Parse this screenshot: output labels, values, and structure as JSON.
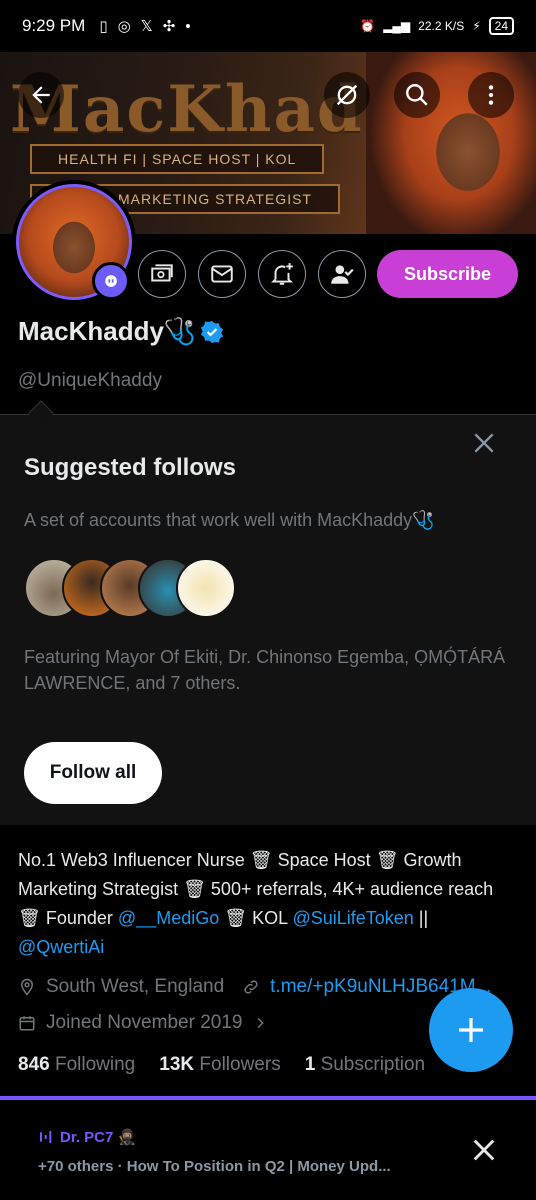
{
  "status": {
    "time": "9:29 PM",
    "left_icons": [
      "sim-icon",
      "whatsapp-icon",
      "x-icon",
      "app-icon",
      "dot-icon"
    ],
    "right_text": "22.2 K/S",
    "battery": "24"
  },
  "banner": {
    "title": "MacKhaddy",
    "tag1": "HEALTH FI | SPACE HOST | KOL",
    "tag2": "MARKETING STRATEGIST"
  },
  "actions": {
    "subscribe_label": "Subscribe",
    "icons": [
      "money-icon",
      "message-icon",
      "notify-plus-icon",
      "following-icon"
    ]
  },
  "profile": {
    "display_name": "MacKhaddy🩺",
    "handle": "@UniqueKhaddy"
  },
  "suggested": {
    "title": "Suggested follows",
    "description": "A set of accounts that work well with MacKhaddy🩺",
    "featuring": "Featuring Mayor Of Ekiti, Dr. Chinonso Egemba, ỌMỌ́TÁRÁ LAWRENCE, and 7 others.",
    "follow_all_label": "Follow all"
  },
  "bio": {
    "part1": "No.1 Web3 Influencer Nurse 🗑 Space Host 🗑 Growth Marketing Strategist 🗑 500+ referrals, 4K+ audience reach 🗑 Founder ",
    "mention1": "@__MediGo",
    "part2": " 🗑 KOL ",
    "mention2": "@SuiLifeToken",
    "part3": " || ",
    "mention3": "@QwertiAi"
  },
  "meta": {
    "location": "South West, England",
    "website": "t.me/+pK9uNLHJB641M...",
    "joined": "Joined November 2019"
  },
  "stats": {
    "following_count": "846",
    "following_label": "Following",
    "followers_count": "13K",
    "followers_label": "Followers",
    "subscription_count": "1",
    "subscription_label": "Subscription"
  },
  "spaces": {
    "host": "Dr. PC7 🥷🏽",
    "title": "+70 others · How To Position in Q2 | Money Upd..."
  },
  "colors": {
    "accent": "#1d9bf0",
    "subscribe": "#c93fd6",
    "spaces": "#7856ff"
  }
}
